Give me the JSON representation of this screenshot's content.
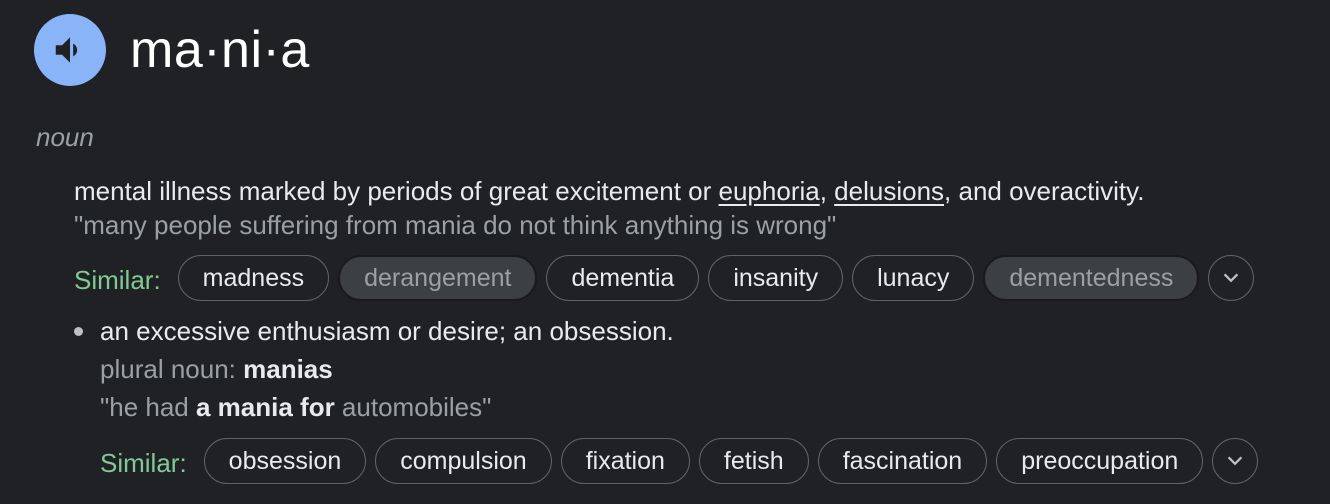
{
  "entry": {
    "headword": "ma·ni·a",
    "part_of_speech": "noun",
    "speaker_icon": "speaker-icon",
    "speaker_color": "#8ab4f8"
  },
  "sense1": {
    "def_before": "mental illness marked by periods of great excitement or ",
    "link1": "euphoria",
    "sep": ", ",
    "link2": "delusions",
    "def_after": ", and overactivity.",
    "example": "\"many people suffering from mania do not think anything is wrong\"",
    "similar_label": "Similar:",
    "similar": [
      "madness",
      "derangement",
      "dementia",
      "insanity",
      "lunacy",
      "dementedness"
    ]
  },
  "sense2": {
    "definition": "an excessive enthusiasm or desire; an obsession.",
    "plural_label": "plural noun: ",
    "plural_value": "manias",
    "example_open": "\"he had ",
    "example_bold": "a mania for",
    "example_close": " automobiles\"",
    "similar_label": "Similar:",
    "similar": [
      "obsession",
      "compulsion",
      "fixation",
      "fetish",
      "fascination",
      "preoccupation"
    ]
  },
  "colors": {
    "background": "#202124",
    "similar_label": "#81c995",
    "muted_text": "#9aa0a6"
  }
}
